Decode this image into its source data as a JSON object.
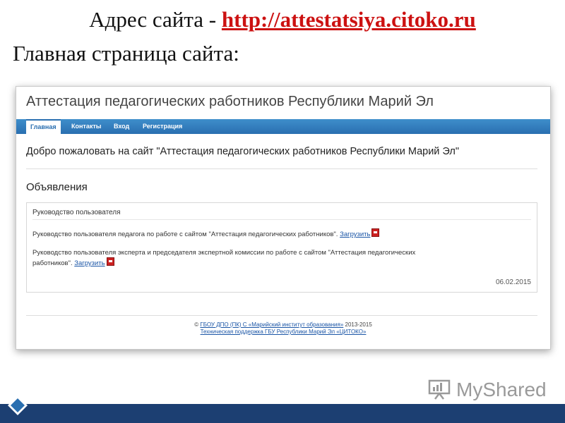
{
  "slide": {
    "title_prefix": "Адрес сайта - ",
    "title_url": "http://attestatsiya.citoko.ru",
    "subtitle": "Главная страница сайта:"
  },
  "site": {
    "title": "Аттестация педагогических работников Республики Марий Эл",
    "nav": [
      {
        "label": "Главная",
        "active": true
      },
      {
        "label": "Контакты",
        "active": false
      },
      {
        "label": "Вход",
        "active": false
      },
      {
        "label": "Регистрация",
        "active": false
      }
    ],
    "welcome": "Добро пожаловать на сайт \"Аттестация педагогических работников Республики Марий Эл\"",
    "announcements": {
      "heading": "Объявления",
      "box_title": "Руководство пользователя",
      "items": [
        {
          "text": "Руководство пользователя педагога по работе с сайтом \"Аттестация педагогических работников\". ",
          "link": "Загрузить"
        },
        {
          "text_line1": "Руководство пользователя эксперта и председателя экспертной комиссии по работе с сайтом \"Аттестация педагогических",
          "text_line2": "работников\". ",
          "link": "Загрузить"
        }
      ],
      "date": "06.02.2015"
    },
    "footer": {
      "copyright_prefix": "© ",
      "org_link": "ГБОУ ДПО (ПК) С «Марийский институт образования»",
      "years": " 2013-2015",
      "support_link": "Техническая поддержка ГБУ Республики Марий Эл «ЦИТОКО»"
    }
  },
  "watermark": {
    "text": "MyShared"
  },
  "colors": {
    "url_red": "#cc1111",
    "nav_blue": "#2a6fb0",
    "link_blue": "#1a55a6",
    "bottom_bar": "#1c3f72"
  }
}
